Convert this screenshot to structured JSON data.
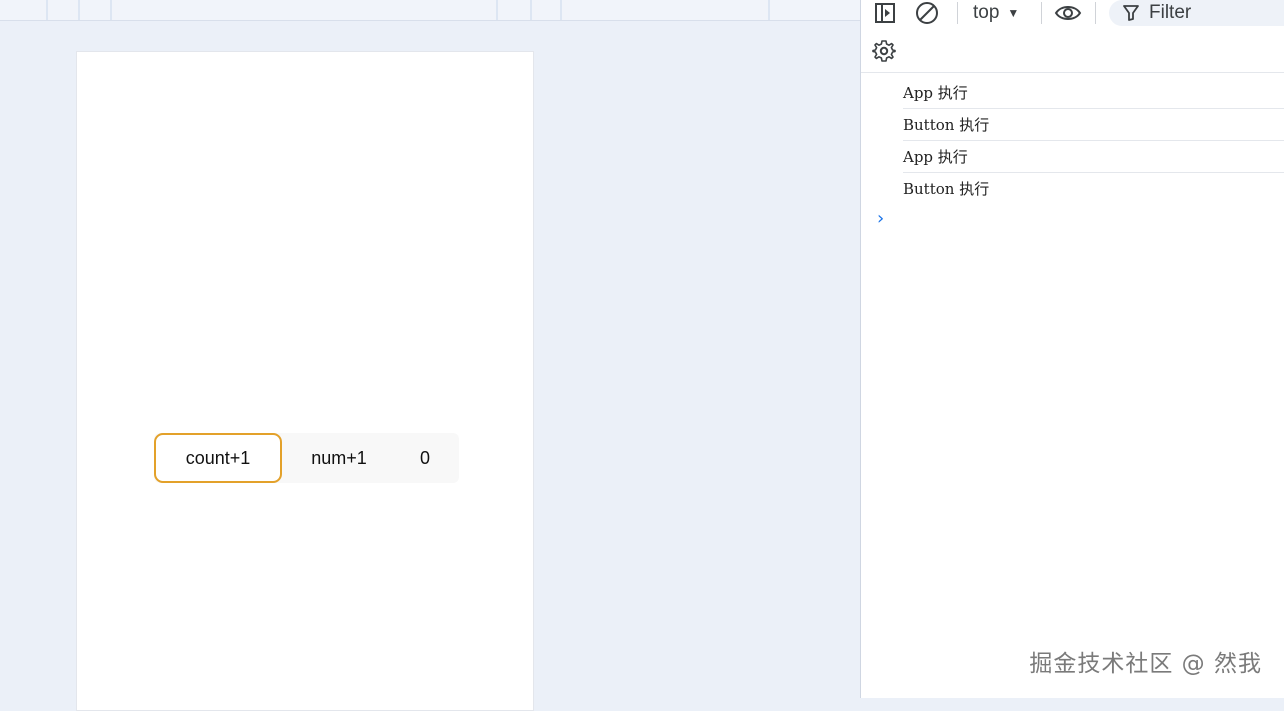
{
  "app": {
    "buttons": {
      "count_label": "count+1",
      "num_label": "num+1"
    },
    "num_value": "0"
  },
  "devtools": {
    "context": "top",
    "filter_placeholder": "Filter",
    "logs": [
      {
        "text": "App 执行"
      },
      {
        "text": "Button 执行"
      },
      {
        "text": "App 执行"
      },
      {
        "text": "Button 执行"
      }
    ],
    "prompt_symbol": "›"
  },
  "watermark": "掘金技术社区 @ 然我",
  "colors": {
    "accent_border": "#e3a12a",
    "prompt": "#1a73e8",
    "background": "#ebf0f8"
  }
}
